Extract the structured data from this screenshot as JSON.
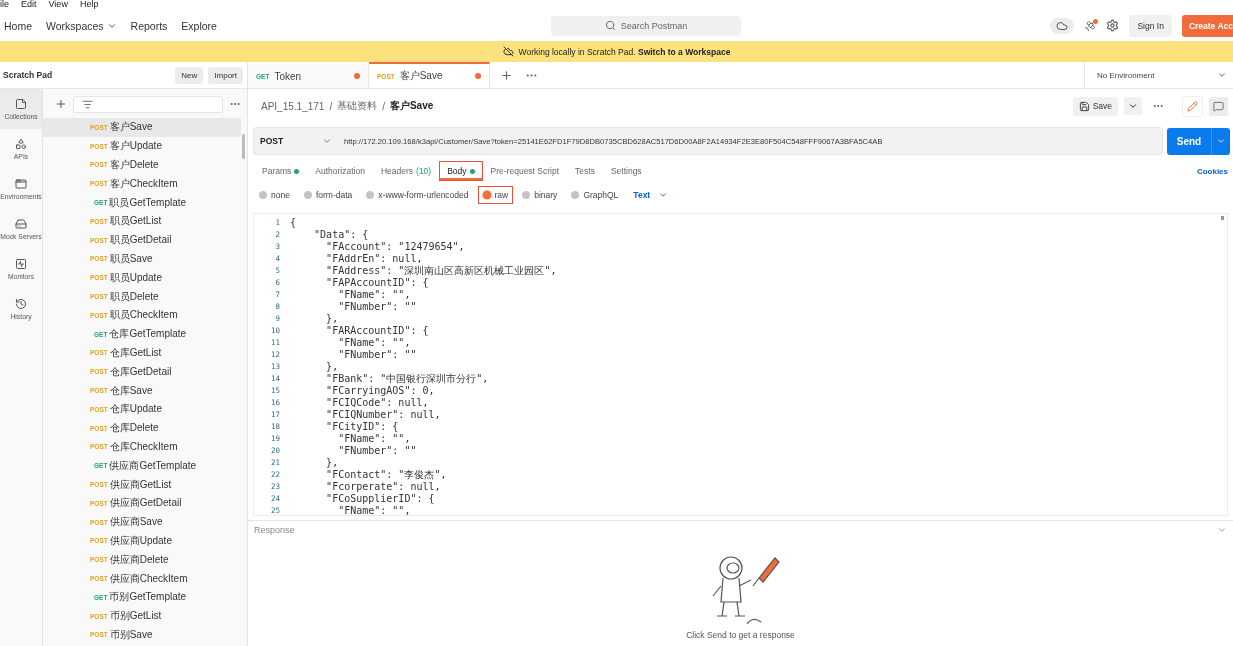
{
  "menu_bar": [
    "ile",
    "Edit",
    "View",
    "Help"
  ],
  "header": {
    "nav": [
      {
        "label": "Home",
        "dropdown": false
      },
      {
        "label": "Workspaces",
        "dropdown": true
      },
      {
        "label": "Reports",
        "dropdown": false
      },
      {
        "label": "Explore",
        "dropdown": false
      }
    ],
    "search": {
      "placeholder": "Search Postman"
    },
    "sign_in": "Sign In",
    "create_account": "Create Acc"
  },
  "banner": "Working locally in Scratch Pad. **Switch to a Workspace**",
  "sidebar": {
    "title": "Scratch Pad",
    "buttons": [
      "New",
      "Import"
    ],
    "rail": [
      {
        "label": "Collections",
        "selected": true
      },
      {
        "label": "APIs",
        "selected": false
      },
      {
        "label": "Environments",
        "selected": false
      },
      {
        "label": "Mock Servers",
        "selected": false
      },
      {
        "label": "Monitors",
        "selected": false
      },
      {
        "label": "History",
        "selected": false
      }
    ],
    "tree": [
      {
        "method": "POST",
        "color": "#e3a21a",
        "name": "客户Save",
        "selected": true
      },
      {
        "method": "POST",
        "color": "#e3a21a",
        "name": "客户Update",
        "selected": false
      },
      {
        "method": "POST",
        "color": "#e3a21a",
        "name": "客户Delete",
        "selected": false
      },
      {
        "method": "POST",
        "color": "#e3a21a",
        "name": "客户CheckItem",
        "selected": false
      },
      {
        "method": "GET",
        "color": "#1fa86a",
        "name": "职员GetTemplate",
        "selected": false
      },
      {
        "method": "POST",
        "color": "#e3a21a",
        "name": "职员GetList",
        "selected": false
      },
      {
        "method": "POST",
        "color": "#e3a21a",
        "name": "职员GetDetail",
        "selected": false
      },
      {
        "method": "POST",
        "color": "#e3a21a",
        "name": "职员Save",
        "selected": false
      },
      {
        "method": "POST",
        "color": "#e3a21a",
        "name": "职员Update",
        "selected": false
      },
      {
        "method": "POST",
        "color": "#e3a21a",
        "name": "职员Delete",
        "selected": false
      },
      {
        "method": "POST",
        "color": "#e3a21a",
        "name": "职员CheckItem",
        "selected": false
      },
      {
        "method": "GET",
        "color": "#1fa86a",
        "name": "仓库GetTemplate",
        "selected": false
      },
      {
        "method": "POST",
        "color": "#e3a21a",
        "name": "仓库GetList",
        "selected": false
      },
      {
        "method": "POST",
        "color": "#e3a21a",
        "name": "仓库GetDetail",
        "selected": false
      },
      {
        "method": "POST",
        "color": "#e3a21a",
        "name": "仓库Save",
        "selected": false
      },
      {
        "method": "POST",
        "color": "#e3a21a",
        "name": "仓库Update",
        "selected": false
      },
      {
        "method": "POST",
        "color": "#e3a21a",
        "name": "仓库Delete",
        "selected": false
      },
      {
        "method": "POST",
        "color": "#e3a21a",
        "name": "仓库CheckItem",
        "selected": false
      },
      {
        "method": "GET",
        "color": "#1fa86a",
        "name": "供应商GetTemplate",
        "selected": false
      },
      {
        "method": "POST",
        "color": "#e3a21a",
        "name": "供应商GetList",
        "selected": false
      },
      {
        "method": "POST",
        "color": "#e3a21a",
        "name": "供应商GetDetail",
        "selected": false
      },
      {
        "method": "POST",
        "color": "#e3a21a",
        "name": "供应商Save",
        "selected": false
      },
      {
        "method": "POST",
        "color": "#e3a21a",
        "name": "供应商Update",
        "selected": false
      },
      {
        "method": "POST",
        "color": "#e3a21a",
        "name": "供应商Delete",
        "selected": false
      },
      {
        "method": "POST",
        "color": "#e3a21a",
        "name": "供应商CheckItem",
        "selected": false
      },
      {
        "method": "GET",
        "color": "#1fa86a",
        "name": "币别GetTemplate",
        "selected": false
      },
      {
        "method": "POST",
        "color": "#e3a21a",
        "name": "币别GetList",
        "selected": false
      },
      {
        "method": "POST",
        "color": "#e3a21a",
        "name": "币别Save",
        "selected": false
      }
    ]
  },
  "request_tabs": [
    {
      "method": "GET",
      "color": "#1fa86a",
      "name": "Token",
      "selected": false,
      "unsaved": true
    },
    {
      "method": "POST",
      "color": "#e3a21a",
      "name": "客户Save",
      "selected": true,
      "unsaved": true
    }
  ],
  "environment": "No Environment",
  "breadcrumb": [
    "API_15.1_171",
    "/",
    "基础资料",
    "/",
    "客户Save"
  ],
  "save": "Save",
  "request": {
    "method": "POST",
    "url": "http://172.20.109.168/k3api/Customer/Save?token=25141E62FD1F79D8DB0735CBD628AC517D6D00A8F2A14934F2E3E80F504C548FFF9067A3BFA5C4AB",
    "send": "Send"
  },
  "options_tabs": [
    {
      "label": "Params",
      "dot": true,
      "selected": false,
      "highlighted": false
    },
    {
      "label": "Authorization",
      "dot": false,
      "selected": false,
      "highlighted": false
    },
    {
      "label": "Headers",
      "count": "(10)",
      "dot": false,
      "selected": false,
      "highlighted": false
    },
    {
      "label": "Body",
      "dot": true,
      "selected": true,
      "highlighted": true
    },
    {
      "label": "Pre-request Script",
      "dot": false,
      "selected": false,
      "highlighted": false
    },
    {
      "label": "Tests",
      "dot": false,
      "selected": false,
      "highlighted": false
    },
    {
      "label": "Settings",
      "dot": false,
      "selected": false,
      "highlighted": false
    }
  ],
  "cookies": "Cookies",
  "body_types": [
    {
      "label": "none",
      "selected": false,
      "highlighted": false
    },
    {
      "label": "form-data",
      "selected": false,
      "highlighted": false
    },
    {
      "label": "x-www-form-urlencoded",
      "selected": false,
      "highlighted": false
    },
    {
      "label": "raw",
      "selected": true,
      "highlighted": true
    },
    {
      "label": "binary",
      "selected": false,
      "highlighted": false
    },
    {
      "label": "GraphQL",
      "selected": false,
      "highlighted": false
    }
  ],
  "format": "Text",
  "code_lines": [
    {
      "number": "1",
      "text": "{"
    },
    {
      "number": "2",
      "text": "    \"Data\": {"
    },
    {
      "number": "3",
      "text": "      \"FAccount\": \"12479654\","
    },
    {
      "number": "4",
      "text": "      \"FAddrEn\": null,"
    },
    {
      "number": "5",
      "text": "      \"FAddress\": \"深圳南山区高新区机械工业园区\","
    },
    {
      "number": "6",
      "text": "      \"FAPAccountID\": {"
    },
    {
      "number": "7",
      "text": "        \"FName\": \"\","
    },
    {
      "number": "8",
      "text": "        \"FNumber\": \"\""
    },
    {
      "number": "9",
      "text": "      },"
    },
    {
      "number": "10",
      "text": "      \"FARAccountID\": {"
    },
    {
      "number": "11",
      "text": "        \"FName\": \"\","
    },
    {
      "number": "12",
      "text": "        \"FNumber\": \"\""
    },
    {
      "number": "13",
      "text": "      },"
    },
    {
      "number": "14",
      "text": "      \"FBank\": \"中国银行深圳市分行\","
    },
    {
      "number": "15",
      "text": "      \"FCarryingAOS\": 0,"
    },
    {
      "number": "16",
      "text": "      \"FCIQCode\": null,"
    },
    {
      "number": "17",
      "text": "      \"FCIQNumber\": null,"
    },
    {
      "number": "18",
      "text": "      \"FCityID\": {"
    },
    {
      "number": "19",
      "text": "        \"FName\": \"\","
    },
    {
      "number": "20",
      "text": "        \"FNumber\": \"\""
    },
    {
      "number": "21",
      "text": "      },"
    },
    {
      "number": "22",
      "text": "      \"FContact\": \"李俊杰\","
    },
    {
      "number": "23",
      "text": "      \"Fcorperate\": null,"
    },
    {
      "number": "24",
      "text": "      \"FCoSupplierID\": {"
    },
    {
      "number": "25",
      "text": "        \"FName\": \"\","
    }
  ],
  "response": {
    "title": "Response",
    "hint": "Click Send to get a response"
  }
}
